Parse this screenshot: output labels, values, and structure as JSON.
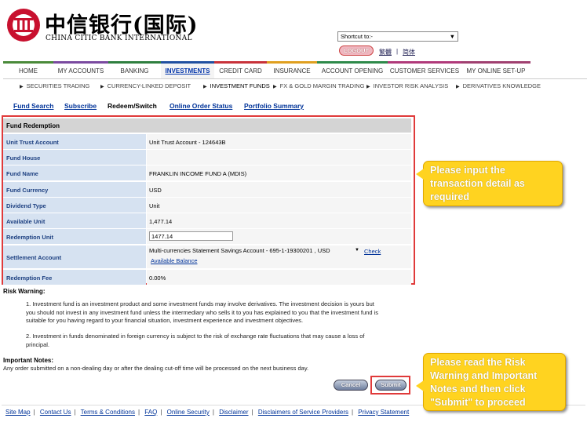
{
  "brand": {
    "name_cn": "中信银行(国际)",
    "name_en": "CHINA CITIC BANK INTERNATIONAL",
    "accent": "#c8102e"
  },
  "header": {
    "shortcut_value": "Shortcut to:-",
    "logout_label": "LOGOUT",
    "lang_traditional": "繁體",
    "lang_simplified": "简体",
    "lang_separator": "|"
  },
  "main_nav": {
    "items": [
      {
        "label": "HOME",
        "color": "#4a8a3a"
      },
      {
        "label": "MY ACCOUNTS",
        "color": "#7a4aa0"
      },
      {
        "label": "BANKING",
        "color": "#2f7f3f"
      },
      {
        "label": "INVESTMENTS",
        "color": "#2050a0"
      },
      {
        "label": "CREDIT CARD",
        "color": "#c8323a"
      },
      {
        "label": "INSURANCE",
        "color": "#e0a020"
      },
      {
        "label": "ACCOUNT OPENING",
        "color": "#2e8a4a"
      },
      {
        "label": "CUSTOMER SERVICES",
        "color": "#b03a7a"
      },
      {
        "label": "MY ONLINE SET-UP",
        "color": "#a04070"
      }
    ],
    "active": "INVESTMENTS"
  },
  "sub_nav": {
    "items": [
      "SECURITIES TRADING",
      "CURRENCY-LINKED DEPOSIT",
      "INVESTMENT FUNDS",
      "FX & GOLD MARGIN TRADING",
      "INVESTOR RISK ANALYSIS",
      "DERIVATIVES KNOWLEDGE"
    ],
    "active": "INVESTMENT FUNDS"
  },
  "tabs": {
    "items": [
      "Fund Search",
      "Subscribe",
      "Redeem/Switch",
      "Online Order Status",
      "Portfolio Summary"
    ],
    "active": "Redeem/Switch"
  },
  "form": {
    "title": "Fund Redemption",
    "rows": [
      {
        "label": "Unit Trust Account",
        "value": "Unit Trust Account - 124643B"
      },
      {
        "label": "Fund House",
        "value": ""
      },
      {
        "label": "Fund Name",
        "value": "FRANKLIN INCOME FUND A (MDIS)"
      },
      {
        "label": "Fund Currency",
        "value": "USD"
      },
      {
        "label": "Dividend Type",
        "value": "Unit"
      },
      {
        "label": "Available Unit",
        "value": "1,477.14"
      },
      {
        "label": "Redemption Unit",
        "value": "1477.14"
      },
      {
        "label": "Settlement Account",
        "value": "Multi-currencies Statement Savings Account - 695-1-19300201 , USD"
      },
      {
        "label": "Redemption Fee",
        "value": "0.00%"
      }
    ],
    "check_balance_link_1": "Check",
    "check_balance_link_2": "Available Balance"
  },
  "risk": {
    "title": "Risk Warning:",
    "para1": [
      "1. Investment fund is an investment product and some investment funds may involve derivatives. The investment decision is yours but",
      "you should not invest in any investment fund unless the intermediary who sells it to you has explained to you that the investment fund is",
      "suitable for you having regard to your financial situation, investment experience and investment objectives."
    ],
    "para2": [
      "2. Investment in funds denominated in foreign currency is subject to the risk of exchange rate fluctuations that may cause a loss of",
      "principal."
    ]
  },
  "important": {
    "title": "Important Notes:",
    "text": "Any order submitted on a non-dealing day or after the dealing cut-off time will be processed on the next business day."
  },
  "buttons": {
    "cancel": "Cancel",
    "submit": "Submit"
  },
  "footer": {
    "links": [
      "Site Map",
      "Contact Us",
      "Terms & Conditions",
      "FAQ",
      "Online Security",
      "Disclaimer",
      "Disclaimers of Service Providers",
      "Privacy Statement"
    ]
  },
  "callouts": {
    "input": [
      "Please input the",
      "transaction detail as",
      "required"
    ],
    "submit": [
      "Please read the Risk",
      "Warning and Important",
      "Notes and then click",
      "\"Submit\" to proceed"
    ]
  }
}
